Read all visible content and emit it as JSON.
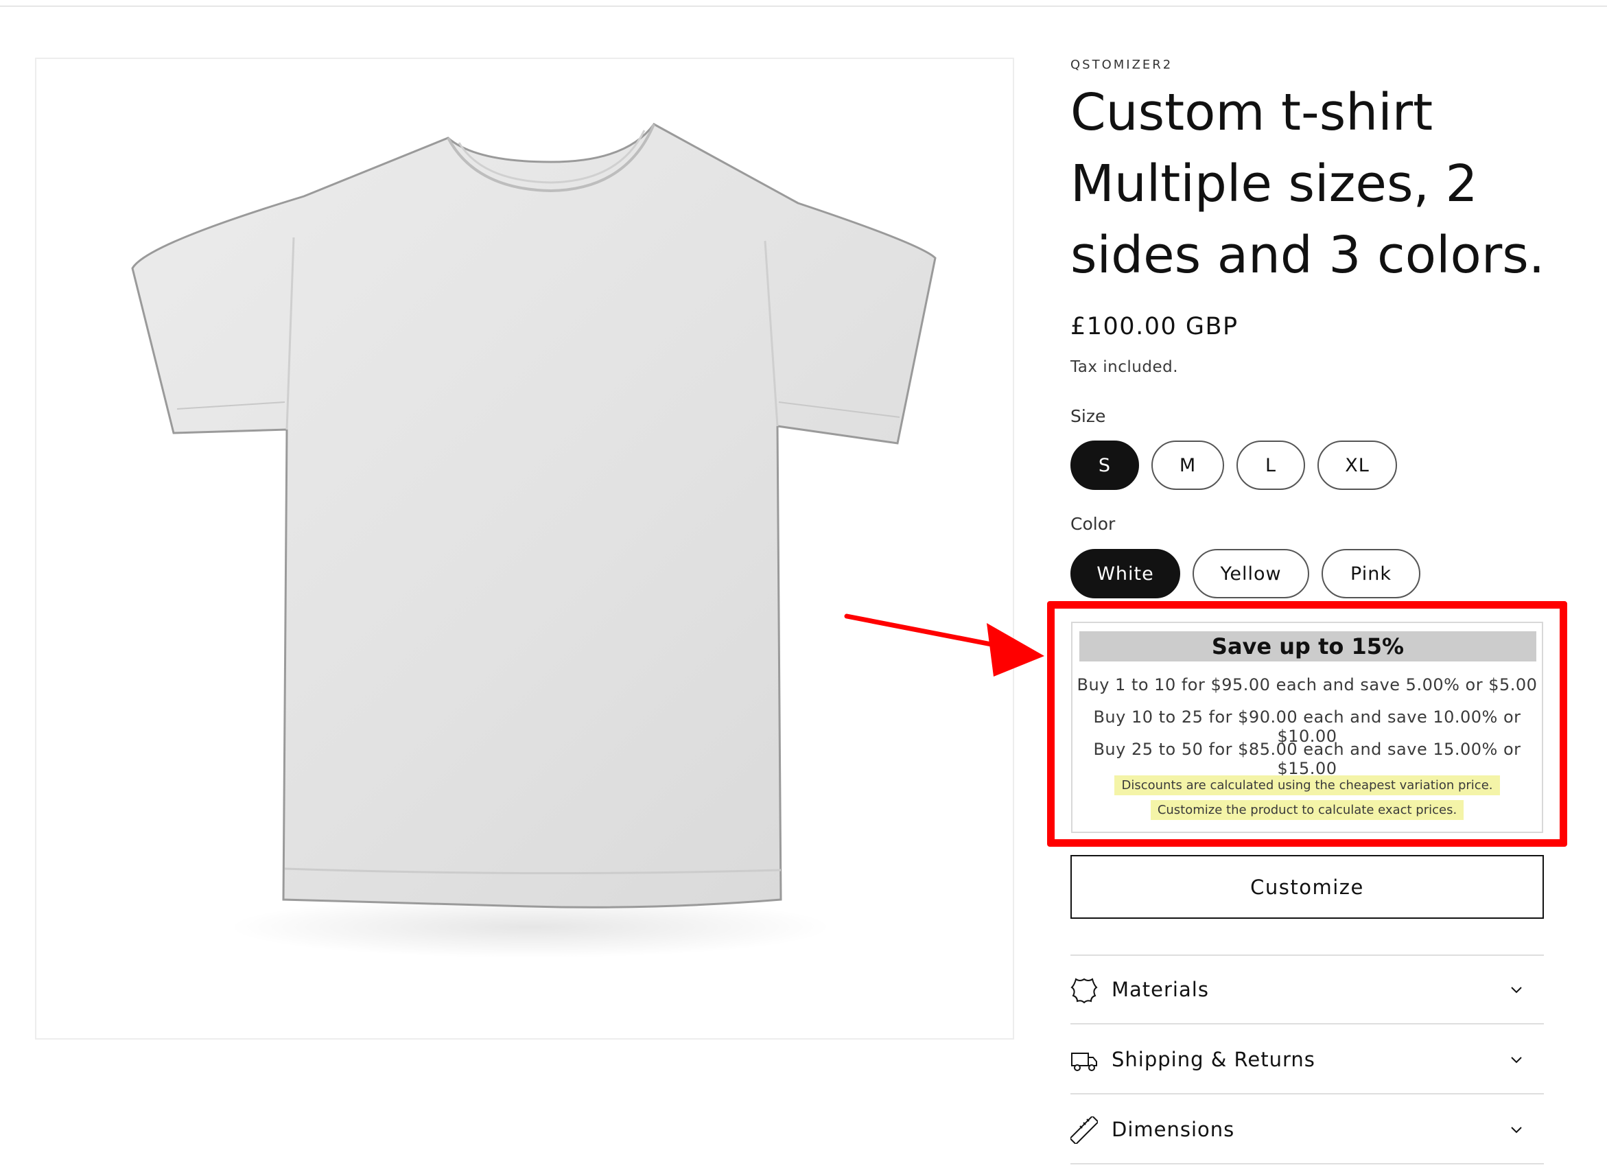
{
  "product": {
    "vendor": "QSTOMIZER2",
    "title": "Custom t-shirt Multiple sizes, 2 sides and 3 colors.",
    "price": "£100.00 GBP",
    "tax_note": "Tax included."
  },
  "options": {
    "size": {
      "label": "Size",
      "values": [
        "S",
        "M",
        "L",
        "XL"
      ],
      "selected": "S"
    },
    "color": {
      "label": "Color",
      "values": [
        "White",
        "Yellow",
        "Pink"
      ],
      "selected": "White"
    }
  },
  "discount": {
    "heading": "Save up to 15%",
    "tiers": [
      "Buy 1 to 10 for $95.00 each and save 5.00% or $5.00",
      "Buy 10 to 25 for $90.00 each and save 10.00% or $10.00",
      "Buy 25 to 50 for $85.00 each and save 15.00% or $15.00"
    ],
    "notes": [
      "Discounts are calculated using the cheapest variation price.",
      "Customize the product to calculate exact prices."
    ]
  },
  "actions": {
    "customize_label": "Customize"
  },
  "accordion": [
    {
      "label": "Materials",
      "icon": "leather-icon"
    },
    {
      "label": "Shipping & Returns",
      "icon": "truck-icon"
    },
    {
      "label": "Dimensions",
      "icon": "ruler-icon"
    }
  ],
  "colors": {
    "annotation_red": "#ff0000",
    "selected_pill": "#121212",
    "note_highlight": "#f4f4a8",
    "discount_header_bg": "#cccccc"
  }
}
